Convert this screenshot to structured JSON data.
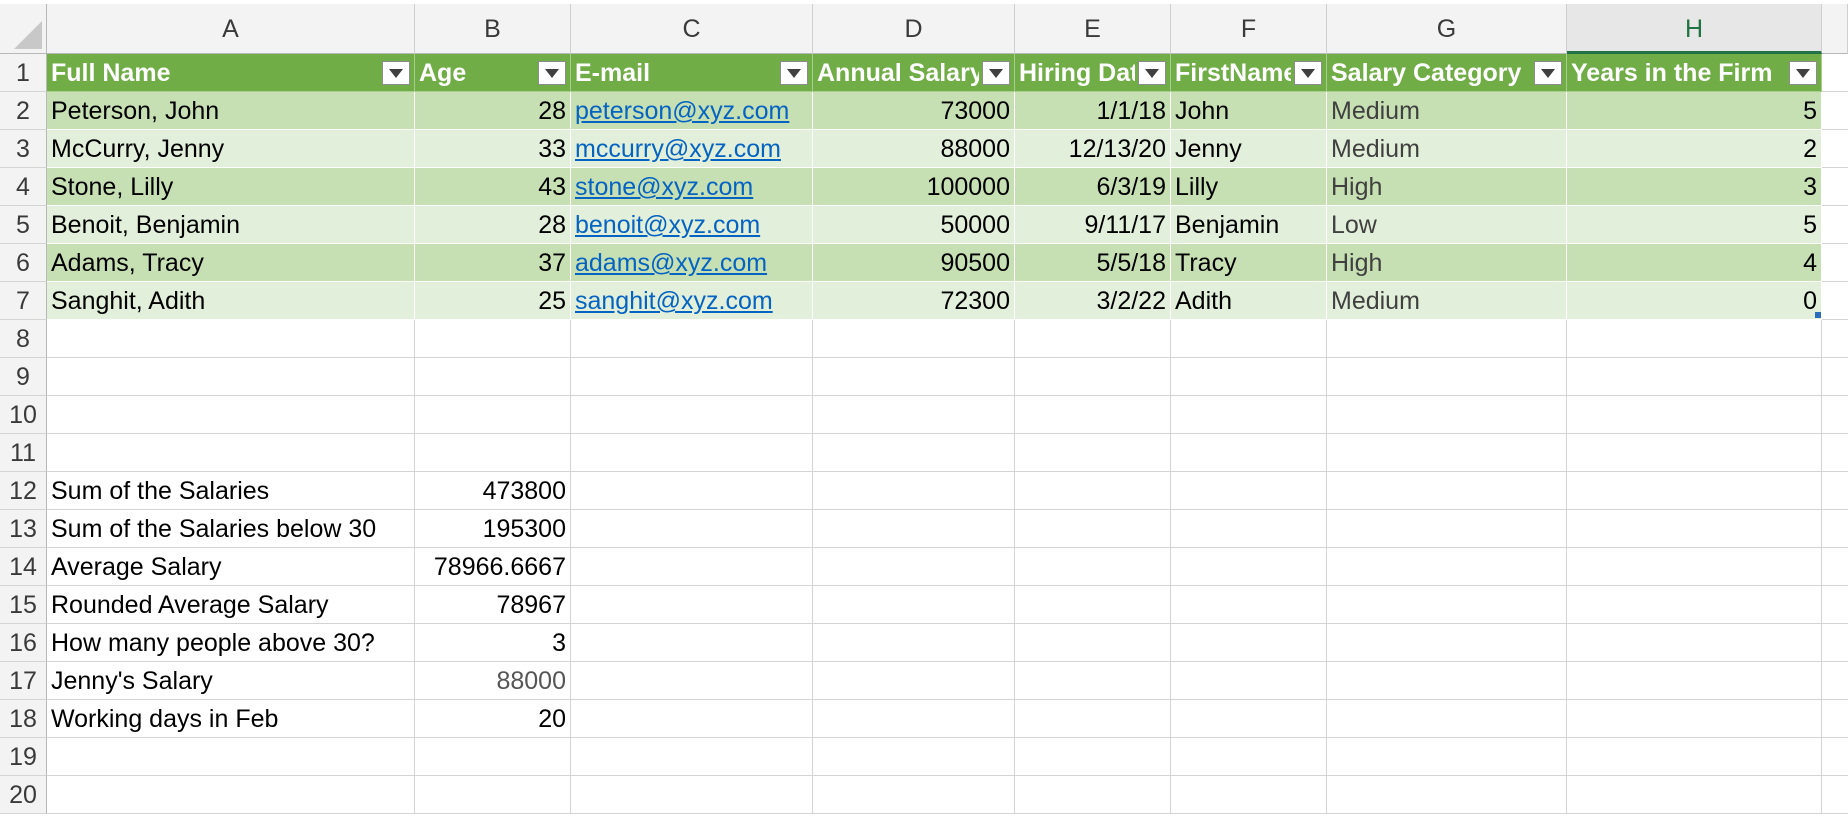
{
  "columns": [
    "A",
    "B",
    "C",
    "D",
    "E",
    "F",
    "G",
    "H"
  ],
  "active_column": "H",
  "row_numbers": [
    "1",
    "2",
    "3",
    "4",
    "5",
    "6",
    "7",
    "8",
    "9",
    "10",
    "11",
    "12",
    "13",
    "14",
    "15",
    "16",
    "17",
    "18",
    "19",
    "20"
  ],
  "table": {
    "headers": [
      "Full Name",
      "Age",
      "E-mail",
      "Annual Salary",
      "Hiring Date",
      "FirstName",
      "Salary Category",
      "Years in the Firm"
    ],
    "rows": [
      [
        "Peterson, John",
        "28",
        "peterson@xyz.com",
        "73000",
        "1/1/18",
        "John",
        "Medium",
        "5"
      ],
      [
        "McCurry, Jenny",
        "33",
        "mccurry@xyz.com",
        "88000",
        "12/13/20",
        "Jenny",
        "Medium",
        "2"
      ],
      [
        "Stone, Lilly",
        "43",
        "stone@xyz.com",
        "100000",
        "6/3/19",
        "Lilly",
        "High",
        "3"
      ],
      [
        "Benoit, Benjamin",
        "28",
        "benoit@xyz.com",
        "50000",
        "9/11/17",
        "Benjamin",
        "Low",
        "5"
      ],
      [
        "Adams, Tracy",
        "37",
        "adams@xyz.com",
        "90500",
        "5/5/18",
        "Tracy",
        "High",
        "4"
      ],
      [
        "Sanghit, Adith",
        "25",
        "sanghit@xyz.com",
        "72300",
        "3/2/22",
        "Adith",
        "Medium",
        "0"
      ]
    ]
  },
  "summary": [
    {
      "label": "Sum of the Salaries",
      "value": "473800"
    },
    {
      "label": "Sum of the Salaries below 30",
      "value": "195300"
    },
    {
      "label": "Average Salary",
      "value": "78966.6667"
    },
    {
      "label": "Rounded Average Salary",
      "value": "78967"
    },
    {
      "label": "How many people above 30?",
      "value": "3"
    },
    {
      "label": "Jenny's Salary",
      "value": "88000"
    },
    {
      "label": "Working days in Feb",
      "value": "20"
    }
  ],
  "colors": {
    "header_fill": "#70ad47",
    "band_dark": "#c6e0b4",
    "band_light": "#e2efda",
    "link": "#0563c1",
    "active_header": "#217346"
  }
}
